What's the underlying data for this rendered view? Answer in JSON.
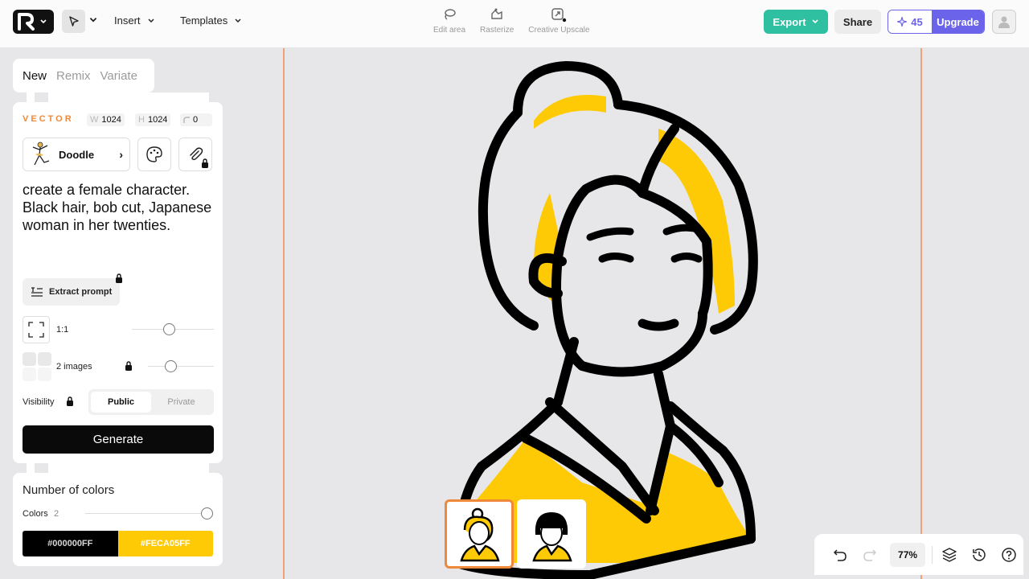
{
  "toolbar": {
    "insert_label": "Insert",
    "templates_label": "Templates",
    "tools": [
      {
        "label": "Edit area",
        "icon": "lasso-icon"
      },
      {
        "label": "Rasterize",
        "icon": "rasterize-icon"
      },
      {
        "label": "Creative Upscale",
        "icon": "upscale-icon"
      }
    ],
    "export_label": "Export",
    "share_label": "Share",
    "credits": "45",
    "upgrade_label": "Upgrade"
  },
  "panel": {
    "tabs": [
      {
        "label": "New",
        "active": true
      },
      {
        "label": "Remix",
        "active": false
      },
      {
        "label": "Variate",
        "active": false
      }
    ],
    "mode_label": "VECTOR",
    "width_key": "W",
    "width": "1024",
    "height_key": "H",
    "height": "1024",
    "corner": "0",
    "style_label": "Doodle",
    "prompt": "create a female character. Black hair, bob cut, Japanese woman in her twenties.",
    "extract_label": "Extract prompt",
    "ratio_label": "1:1",
    "images_label": "2 images",
    "visibility_label": "Visibility",
    "visibility_options": [
      "Public",
      "Private"
    ],
    "visibility_selected": "Public",
    "generate_label": "Generate",
    "colors_title": "Number of colors",
    "colors_key": "Colors",
    "colors_value": "2",
    "palette": [
      {
        "hex_label": "#000000FF",
        "color": "#000000",
        "text_color": "#d8d8d8"
      },
      {
        "hex_label": "#FECA05FF",
        "color": "#FECA05",
        "text_color": "#ffffff"
      }
    ]
  },
  "canvas": {
    "zoom": "77%",
    "accent": "#f0883a",
    "fill_color": "#FECA05"
  }
}
